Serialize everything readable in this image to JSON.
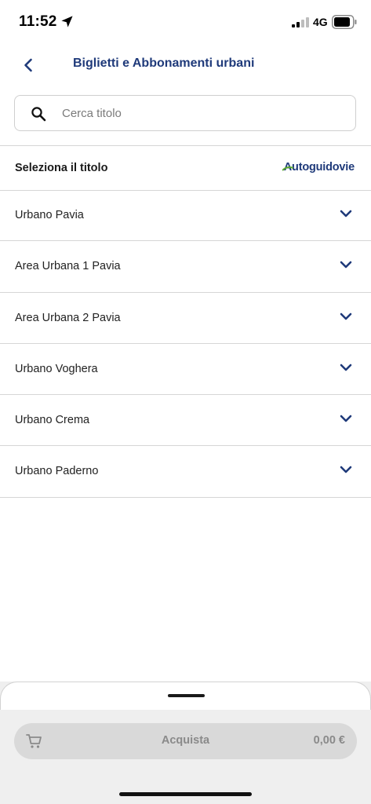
{
  "status_bar": {
    "time": "11:52",
    "network": "4G",
    "icons": [
      "location-arrow-icon",
      "signal-icon",
      "battery-icon"
    ]
  },
  "header": {
    "back_icon": "chevron-left-icon",
    "title": "Biglietti e Abbonamenti urbani"
  },
  "search": {
    "placeholder": "Cerca titolo",
    "value": "",
    "icon": "search-icon"
  },
  "section": {
    "title": "Seleziona il titolo",
    "brand": "Autoguidovie"
  },
  "list": {
    "items": [
      {
        "label": "Urbano Pavia"
      },
      {
        "label": "Area Urbana 1 Pavia"
      },
      {
        "label": "Area Urbana 2 Pavia"
      },
      {
        "label": "Urbano Voghera"
      },
      {
        "label": "Urbano Crema"
      },
      {
        "label": "Urbano Paderno"
      }
    ],
    "item_icon": "chevron-down-icon"
  },
  "checkout": {
    "icon": "cart-icon",
    "label": "Acquista",
    "amount": "0,00 €"
  },
  "colors": {
    "accent": "#1f3a7a",
    "button_bg": "#d9d9d9",
    "button_text": "#8a8a8a",
    "divider": "#d6d6d6"
  }
}
